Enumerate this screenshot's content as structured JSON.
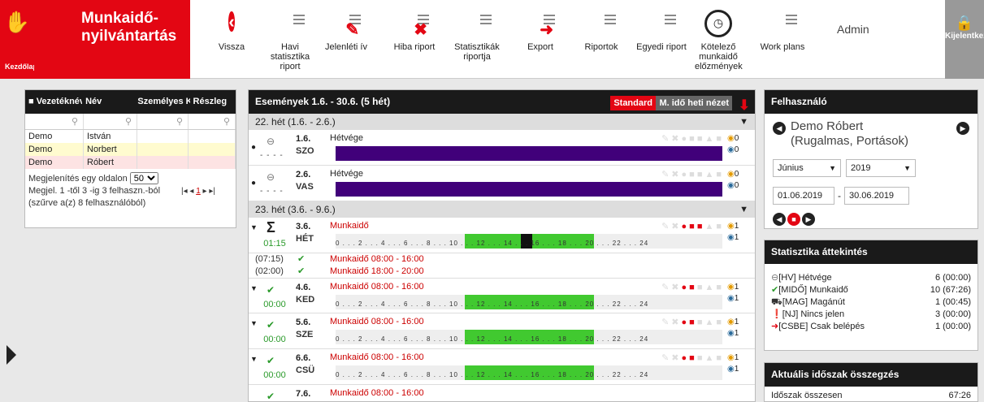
{
  "home": {
    "label": "Kezdőlap"
  },
  "brand": {
    "title": "Munkaidő-nyilvántartás"
  },
  "toolbar": [
    {
      "label": "Vissza",
      "icon": "back-icon"
    },
    {
      "label": "Havi statisztika riport",
      "icon": "report-icon"
    },
    {
      "label": "Jelenléti ív",
      "icon": "attendance-icon"
    },
    {
      "label": "Hiba riport",
      "icon": "error-report-icon"
    },
    {
      "label": "Statisztikák riportja",
      "icon": "stats-report-icon"
    },
    {
      "label": "Export",
      "icon": "export-icon"
    },
    {
      "label": "Riportok",
      "icon": "reports-icon"
    },
    {
      "label": "Egyedi riport",
      "icon": "custom-report-icon"
    },
    {
      "label": "Kötelező munkaidő előzmények",
      "icon": "clock-history-icon"
    },
    {
      "label": "Work plans",
      "icon": "clipboard-icon"
    }
  ],
  "user": "Admin",
  "logout": "Kijelentkezés",
  "users_table": {
    "headers": [
      "Vezetéknév",
      "Név",
      "Személyes Kód",
      "Részleg"
    ],
    "rows": [
      [
        "Demo",
        "István"
      ],
      [
        "Demo",
        "Norbert"
      ],
      [
        "Demo",
        "Róbert"
      ]
    ],
    "page_size_label": "Megjelenítés egy oldalon",
    "page_size": "50",
    "range_text": "Megjel. 1 -től 3 -ig 3 felhaszn.-ból",
    "filter_text": "(szűrve a(z) 8 felhasználóból)",
    "pager": "1"
  },
  "events": {
    "title": "Események 1.6. - 30.6. (5 hét)",
    "standard": "Standard",
    "weekly_view": "M. idő heti nézet",
    "week1": "22. hét (1.6. - 2.6.)",
    "week2": "23. hét (3.6. - 9.6.)",
    "sat": {
      "date": "1.6.",
      "wd": "SZO",
      "title": "Hétvége",
      "dash": "- - - -",
      "c1": "0",
      "c2": "0"
    },
    "sun": {
      "date": "2.6.",
      "wd": "VAS",
      "title": "Hétvége",
      "dash": "- - - -",
      "c1": "0",
      "c2": "0"
    },
    "sum": {
      "date": "3.6.",
      "wd": "HÉT",
      "title": "Munkaidő",
      "time": "01:15",
      "c1": "1",
      "c2": "1"
    },
    "sub1": {
      "p": "(07:15)",
      "t": "Munkaidő  08:00 - 16:00"
    },
    "sub2": {
      "p": "(02:00)",
      "t": "Munkaidő  18:00 - 20:00"
    },
    "d4": {
      "date": "4.6.",
      "wd": "KED",
      "title": "Munkaidő 08:00 - 16:00",
      "time": "00:00",
      "c1": "1",
      "c2": "1"
    },
    "d5": {
      "date": "5.6.",
      "wd": "SZE",
      "title": "Munkaidő 08:00 - 16:00",
      "time": "00:00",
      "c1": "1",
      "c2": "1"
    },
    "d6": {
      "date": "6.6.",
      "wd": "CSÜ",
      "title": "Munkaidő 08:00 - 16:00",
      "time": "00:00",
      "c1": "1",
      "c2": "1"
    },
    "d7": {
      "date": "7.6.",
      "title": "Munkaidő 08:00 - 16:00"
    },
    "ticks": "0 . . . 2 . . . 4 . . . 6 . . . 8 . . . 10 . . . 12 . . . 14 . . . 16 . . . 18 . . . 20 . . . 22 . . . 24"
  },
  "felhasznalo": {
    "title": "Felhasználó",
    "name": "Demo Róbert",
    "group": "(Rugalmas, Portások)",
    "month": "Június",
    "year": "2019",
    "from": "01.06.2019",
    "to": "30.06.2019"
  },
  "stats": {
    "title": "Statisztika áttekintés",
    "rows": [
      {
        "label": "[HV] Hétvége",
        "value": "6 (00:00)"
      },
      {
        "label": "[MIDŐ] Munkaidő",
        "value": "10 (67:26)"
      },
      {
        "label": "[MAG] Magánút",
        "value": "1 (00:45)"
      },
      {
        "label": "[NJ] Nincs jelen",
        "value": "3 (00:00)"
      },
      {
        "label": "[CSBE] Csak belépés",
        "value": "1 (00:00)"
      }
    ]
  },
  "summary": {
    "title": "Aktuális időszak összegzés",
    "row_label": "Időszak összesen",
    "row_value": "67:26"
  }
}
